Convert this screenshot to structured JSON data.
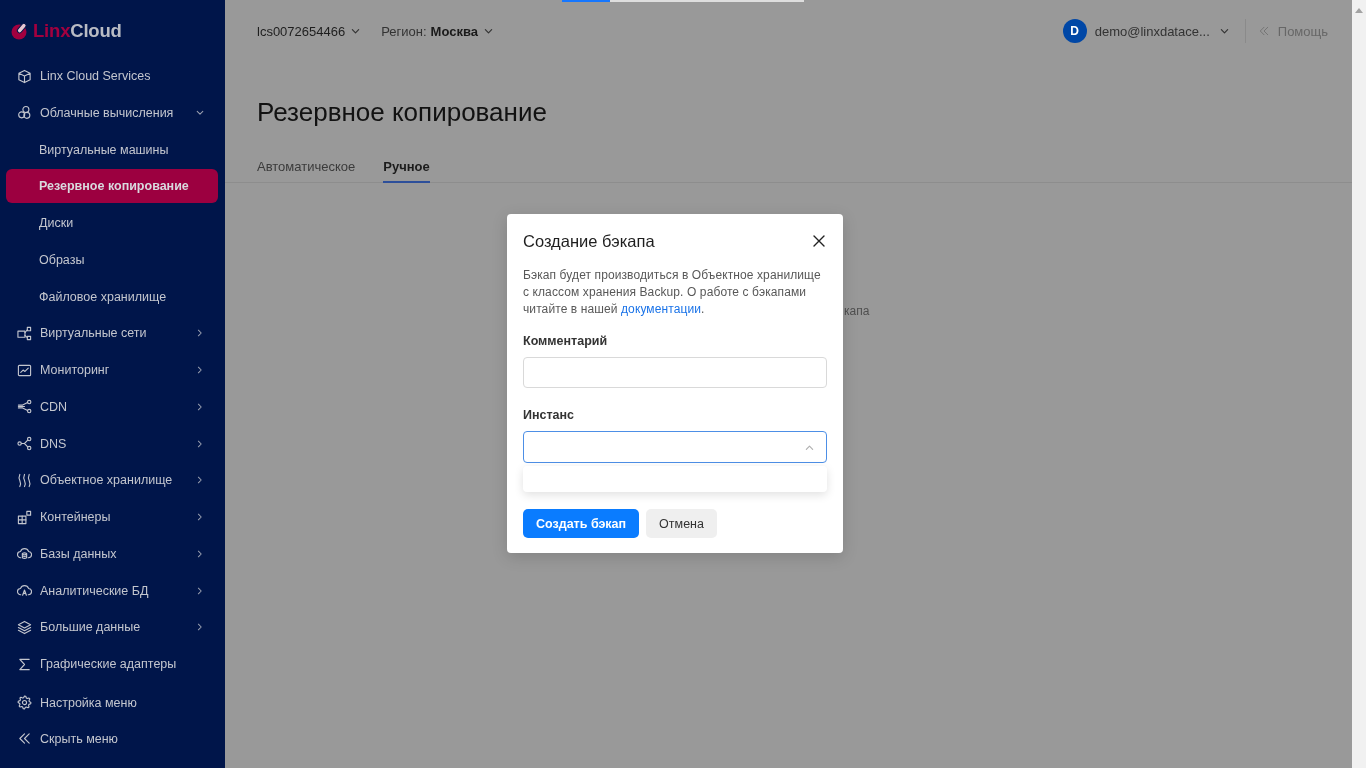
{
  "top_progress": {
    "level": 0.2
  },
  "sidebar": {
    "logo": {
      "brand_first": "Linx",
      "brand_second": "Cloud"
    },
    "items": [
      {
        "label": "Linx Cloud Services",
        "selected": false
      },
      {
        "label": "Облачные вычисления",
        "selected": false,
        "expanded": true,
        "children": [
          {
            "label": "Виртуальные машины",
            "selected": false
          },
          {
            "label": "Резервное копирование",
            "selected": true
          },
          {
            "label": "Диски",
            "selected": false
          },
          {
            "label": "Образы",
            "selected": false
          },
          {
            "label": "Файловое хранилище",
            "selected": false
          }
        ]
      },
      {
        "label": "Виртуальные сети",
        "selected": false,
        "expanded": false
      },
      {
        "label": "Мониторинг",
        "selected": false,
        "expanded": false
      },
      {
        "label": "CDN",
        "selected": false,
        "expanded": false
      },
      {
        "label": "DNS",
        "selected": false,
        "expanded": false
      },
      {
        "label": "Объектное хранилище",
        "selected": false,
        "expanded": false
      },
      {
        "label": "Контейнеры",
        "selected": false,
        "expanded": false
      },
      {
        "label": "Базы данных",
        "selected": false,
        "expanded": false
      },
      {
        "label": "Аналитические БД",
        "selected": false,
        "expanded": false
      },
      {
        "label": "Большие данные",
        "selected": false,
        "expanded": false
      },
      {
        "label": "Графические адаптеры",
        "selected": false
      }
    ],
    "footer_items": [
      {
        "label": "Настройка меню"
      },
      {
        "label": "Скрыть меню"
      }
    ]
  },
  "header": {
    "account": "lcs0072654466",
    "region_label": "Регион:",
    "region_value": "Москва",
    "user": {
      "avatar_letter": "D",
      "email": "demo@linxdatace..."
    },
    "help": "Помощь"
  },
  "page": {
    "title": "Резервное копирование",
    "tabs": [
      {
        "label": "Автоматическое",
        "selected": false
      },
      {
        "label": "Ручное",
        "selected": true
      }
    ],
    "empty_state_text": "капа"
  },
  "modal": {
    "title": "Создание бэкапа",
    "description": "Бэкап будет производиться в Объектное хранилище с классом хранения Backup. О работе с бэкапами читайте в нашей ",
    "link": "документации",
    "description_end": ".",
    "fields": [
      {
        "label": "Комментарий",
        "kind": "text"
      },
      {
        "label": "Инстанс",
        "kind": "select",
        "expanded": true
      }
    ],
    "buttons": [
      {
        "label": "Создать бэкап",
        "kind": "primary"
      },
      {
        "label": "Отмена",
        "kind": "secondary"
      }
    ]
  }
}
